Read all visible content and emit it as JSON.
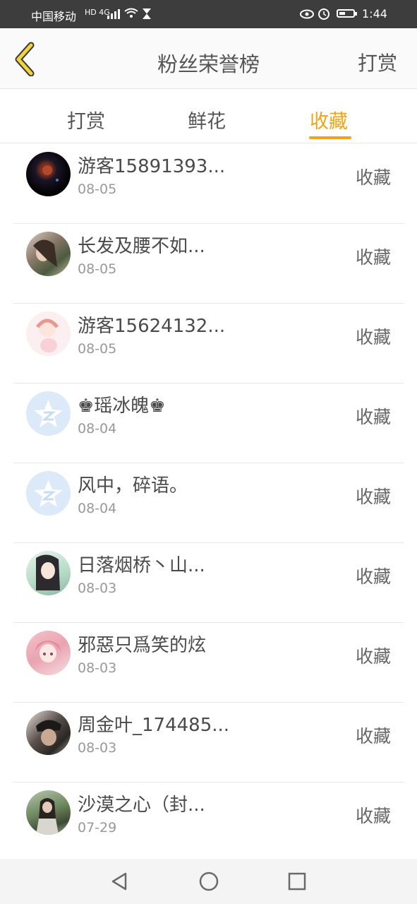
{
  "status_bar": {
    "carrier": "中国移动",
    "network": "HD 4G",
    "time": "1:44",
    "icons": [
      "signal-icon",
      "wifi-icon",
      "hourglass-icon",
      "eye-icon",
      "alarm-icon",
      "battery-icon"
    ]
  },
  "header": {
    "title": "粉丝荣誉榜",
    "right_action": "打赏",
    "back_icon": "chevron-left-icon"
  },
  "tabs": [
    {
      "label": "打赏",
      "active": false
    },
    {
      "label": "鲜花",
      "active": false
    },
    {
      "label": "收藏",
      "active": true
    }
  ],
  "accent_color": "#f0a417",
  "fans": [
    {
      "name": "游客15891393...",
      "date": "08-05",
      "action": "收藏",
      "avatar": "night-sky-avatar"
    },
    {
      "name": "长发及腰不如...",
      "date": "08-05",
      "action": "收藏",
      "avatar": "girl-photo-avatar"
    },
    {
      "name": "游客15624132...",
      "date": "08-05",
      "action": "收藏",
      "avatar": "anime-girl-avatar"
    },
    {
      "name": "♚瑶冰魄♚",
      "date": "08-04",
      "action": "收藏",
      "avatar": "qq-default-avatar"
    },
    {
      "name": "风中，碎语。",
      "date": "08-04",
      "action": "收藏",
      "avatar": "qq-default-avatar"
    },
    {
      "name": "日落烟桥丶山...",
      "date": "08-03",
      "action": "收藏",
      "avatar": "anime-character-avatar"
    },
    {
      "name": "邪惡只爲笑的炫",
      "date": "08-03",
      "action": "收藏",
      "avatar": "pink-hair-anime-avatar"
    },
    {
      "name": "周金叶_174485...",
      "date": "08-03",
      "action": "收藏",
      "avatar": "man-photo-avatar"
    },
    {
      "name": "沙漠之心（封...",
      "date": "07-29",
      "action": "收藏",
      "avatar": "outdoor-photo-avatar"
    }
  ],
  "nav_bar": {
    "icons": [
      "back-triangle-icon",
      "home-circle-icon",
      "recents-square-icon"
    ]
  }
}
